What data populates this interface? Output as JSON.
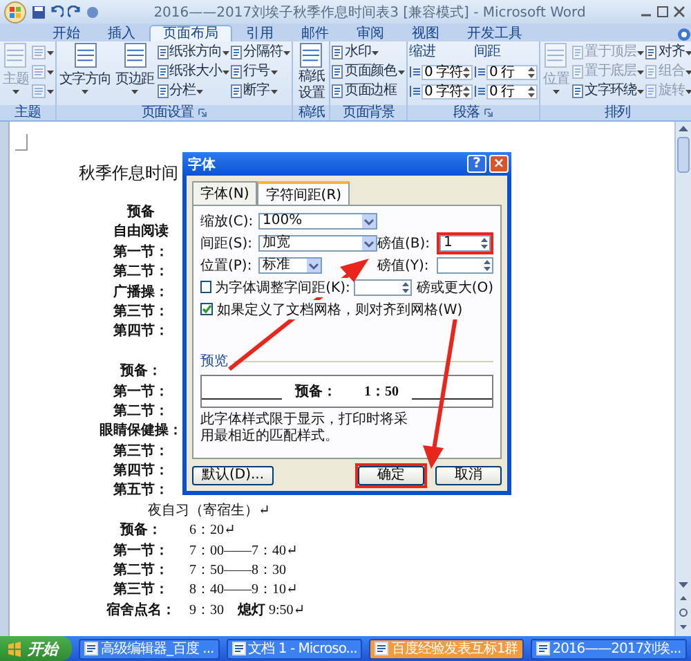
{
  "window": {
    "title": "2016——2017刘埃子秋季作息时间表3 [兼容模式] - Microsoft Word"
  },
  "ribbon_tabs": [
    {
      "label": "开始",
      "selected": false
    },
    {
      "label": "插入",
      "selected": false
    },
    {
      "label": "页面布局",
      "selected": true
    },
    {
      "label": "引用",
      "selected": false
    },
    {
      "label": "邮件",
      "selected": false
    },
    {
      "label": "审阅",
      "selected": false
    },
    {
      "label": "视图",
      "selected": false
    },
    {
      "label": "开发工具",
      "selected": false
    }
  ],
  "ribbon_groups": [
    {
      "label": "主题",
      "launcher": false,
      "columns": [
        [
          {
            "kind": "large",
            "label": "主题",
            "dropdown": true,
            "disabled": true
          }
        ],
        [
          {
            "kind": "icon",
            "dropdown": true,
            "disabled": true
          },
          {
            "kind": "icon",
            "dropdown": true,
            "disabled": true
          },
          {
            "kind": "icon",
            "dropdown": true,
            "disabled": true
          }
        ]
      ]
    },
    {
      "label": "页面设置",
      "launcher": true,
      "columns": [
        [
          {
            "kind": "large",
            "label": "文字方向",
            "dropdown": true,
            "disabled": false
          }
        ],
        [
          {
            "kind": "large",
            "label": "页边距",
            "dropdown": true,
            "disabled": false
          }
        ],
        [
          {
            "kind": "small",
            "label": "纸张方向",
            "dropdown": true,
            "disabled": false
          },
          {
            "kind": "small",
            "label": "纸张大小",
            "dropdown": true,
            "disabled": false
          },
          {
            "kind": "small",
            "label": "分栏",
            "dropdown": true,
            "disabled": false
          }
        ],
        [
          {
            "kind": "small",
            "label": "分隔符",
            "dropdown": true,
            "disabled": false
          },
          {
            "kind": "small",
            "label": "行号",
            "dropdown": true,
            "disabled": false
          },
          {
            "kind": "small",
            "label": "断字",
            "dropdown": true,
            "disabled": false
          }
        ]
      ]
    },
    {
      "label": "稿纸",
      "launcher": false,
      "columns": [
        [
          {
            "kind": "tall",
            "label": "稿纸设置",
            "dropdown": false,
            "disabled": false
          }
        ]
      ]
    },
    {
      "label": "页面背景",
      "launcher": false,
      "columns": [
        [
          {
            "kind": "small",
            "label": "水印",
            "dropdown": true,
            "disabled": false
          },
          {
            "kind": "small",
            "label": "页面颜色",
            "dropdown": true,
            "disabled": false
          },
          {
            "kind": "small",
            "label": "页面边框",
            "dropdown": false,
            "disabled": false
          }
        ]
      ]
    },
    {
      "label": "段落",
      "launcher": true,
      "columns": [
        [
          {
            "kind": "header",
            "label": "缩进",
            "disabled": false
          },
          {
            "kind": "spinner",
            "value": "0 字符",
            "disabled": false
          },
          {
            "kind": "spinner",
            "value": "0 字符",
            "disabled": false
          }
        ],
        [
          {
            "kind": "header",
            "label": "间距",
            "disabled": false
          },
          {
            "kind": "spinner",
            "value": "0 行",
            "disabled": false
          },
          {
            "kind": "spinner",
            "value": "0 行",
            "disabled": false
          }
        ]
      ]
    },
    {
      "label": "排列",
      "launcher": false,
      "columns": [
        [
          {
            "kind": "large",
            "label": "位置",
            "dropdown": true,
            "disabled": true
          }
        ],
        [
          {
            "kind": "small",
            "label": "置于顶层",
            "dropdown": true,
            "disabled": true
          },
          {
            "kind": "small",
            "label": "置于底层",
            "dropdown": true,
            "disabled": true
          },
          {
            "kind": "small",
            "label": "文字环绕",
            "dropdown": true,
            "disabled": false
          }
        ],
        [
          {
            "kind": "small",
            "label": "对齐",
            "dropdown": true,
            "disabled": false
          },
          {
            "kind": "small",
            "label": "组合",
            "dropdown": true,
            "disabled": true
          },
          {
            "kind": "small",
            "label": "旋转",
            "dropdown": true,
            "disabled": true
          }
        ]
      ]
    }
  ],
  "document": {
    "title": "秋季作息时间",
    "sections": [
      {
        "lines": [
          {
            "label": "预备"
          },
          {
            "label": "自由阅读"
          },
          {
            "label": "第一节："
          },
          {
            "label": "第二节："
          },
          {
            "label": "广播操："
          },
          {
            "label": "第三节："
          },
          {
            "label": "第四节："
          }
        ]
      },
      {
        "lines": [
          {
            "label": "预备："
          },
          {
            "label": "第一节："
          },
          {
            "label": "第二节："
          },
          {
            "label": "眼睛保健操："
          },
          {
            "label": "第三节："
          },
          {
            "label": "第四节："
          },
          {
            "label": "第五节："
          }
        ]
      },
      {
        "heading": "夜自习（寄宿生）↵",
        "lines": [
          {
            "label": "预备：",
            "time": "6：20↵"
          },
          {
            "label": "第一节：",
            "time": "7：00——7：40↵"
          },
          {
            "label": "第二节：",
            "time": "7：50——8：30"
          },
          {
            "label": "第三节：",
            "time": "8：40——9：10↵"
          },
          {
            "label": "宿舍点名：",
            "time": "9：30　**熄灯** 9:50↵"
          }
        ]
      }
    ]
  },
  "dialog": {
    "title": "字体",
    "title_buttons": [
      {
        "kind": "help",
        "label": "?"
      },
      {
        "kind": "close",
        "label": "×"
      }
    ],
    "tabs": [
      {
        "label": "字体(N)",
        "selected": false
      },
      {
        "label": "字符间距(R)",
        "selected": true
      }
    ],
    "scale": {
      "label": "缩放(C):",
      "value": "100%"
    },
    "spacing": {
      "label": "间距(S):",
      "value": "加宽"
    },
    "spacing_amount": {
      "label": "磅值(B):",
      "value": "1",
      "highlighted": true
    },
    "position": {
      "label": "位置(P):",
      "value": "标准"
    },
    "position_amount": {
      "label": "磅值(Y):"
    },
    "kerning": {
      "label": "为字体调整字间距(K):",
      "checked": false,
      "suffix": "磅或更大(O)"
    },
    "grid": {
      "label": "如果定义了文档网格，则对齐到网格(W)",
      "checked": true
    },
    "preview": {
      "label": "预览",
      "sample": "预备：　　1：50",
      "note": "此字体样式限于显示，打印时将采用最相近的匹配样式。"
    },
    "buttons": [
      {
        "label": "默认(D)...",
        "highlighted": false
      },
      {
        "label": "确定",
        "highlighted": true
      },
      {
        "label": "取消",
        "highlighted": false
      }
    ]
  },
  "taskbar": {
    "start": "开始",
    "tasks": [
      {
        "label": "高级编辑器_百度 ...",
        "flashing": false
      },
      {
        "label": "文档 1 - Microso...",
        "flashing": false
      },
      {
        "label": "百度经验发表互标1群",
        "flashing": true
      },
      {
        "label": "2016——2017刘埃...",
        "flashing": false
      }
    ]
  }
}
